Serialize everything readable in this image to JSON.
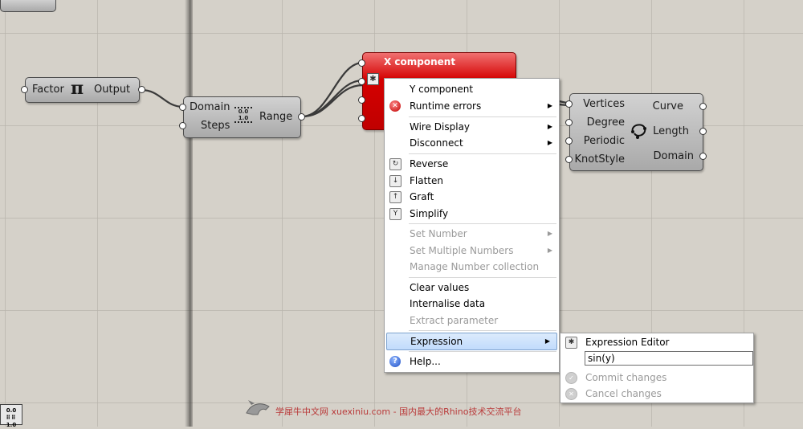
{
  "colors": {
    "canvas": "#d5d1c9",
    "component_fill": "#bcbcbc",
    "error_red": "#d40000",
    "menu_highlight": "#c1dbfc",
    "disabled_text": "#9a9a9a"
  },
  "components": {
    "pi": {
      "input": "Factor",
      "output": "Output",
      "icon": "pi-icon"
    },
    "range": {
      "inputs": [
        "Domain",
        "Steps"
      ],
      "output": "Range",
      "icon": "range-icon",
      "icon_text_top": "0.0",
      "icon_text_bottom": "1.0"
    },
    "x_component": {
      "title": "X component",
      "icon": "expression-star-icon"
    },
    "interpolate": {
      "inputs": [
        "Vertices",
        "Degree",
        "Periodic",
        "KnotStyle"
      ],
      "outputs": [
        "Curve",
        "Length",
        "Domain"
      ],
      "icon": "interpolate-curve-icon"
    }
  },
  "context_menu": {
    "items": [
      {
        "label": "Y component",
        "enabled": true
      },
      {
        "label": "Runtime errors",
        "enabled": true,
        "submenu": true,
        "icon": "error-icon"
      },
      {
        "label": "Wire Display",
        "enabled": true,
        "submenu": true
      },
      {
        "label": "Disconnect",
        "enabled": true,
        "submenu": true
      },
      {
        "label": "Reverse",
        "enabled": true,
        "icon": "reverse-icon"
      },
      {
        "label": "Flatten",
        "enabled": true,
        "icon": "flatten-icon"
      },
      {
        "label": "Graft",
        "enabled": true,
        "icon": "graft-icon"
      },
      {
        "label": "Simplify",
        "enabled": true,
        "icon": "simplify-icon"
      },
      {
        "label": "Set Number",
        "enabled": false,
        "submenu": true
      },
      {
        "label": "Set Multiple Numbers",
        "enabled": false,
        "submenu": true
      },
      {
        "label": "Manage Number collection",
        "enabled": false
      },
      {
        "label": "Clear values",
        "enabled": true
      },
      {
        "label": "Internalise data",
        "enabled": true
      },
      {
        "label": "Extract parameter",
        "enabled": false
      },
      {
        "label": "Expression",
        "enabled": true,
        "submenu": true,
        "highlighted": true
      },
      {
        "label": "Help...",
        "enabled": true,
        "icon": "help-icon"
      }
    ]
  },
  "submenu": {
    "editor_label": "Expression Editor",
    "expression_value": "sin(y)",
    "commit_label": "Commit changes",
    "cancel_label": "Cancel changes"
  },
  "watermark": {
    "text": "学犀牛中文网 xuexiniu.com - 国内最大的Rhino技术交流平台"
  },
  "bottom_icon": {
    "top": "0.0",
    "bottom": "1.0"
  }
}
